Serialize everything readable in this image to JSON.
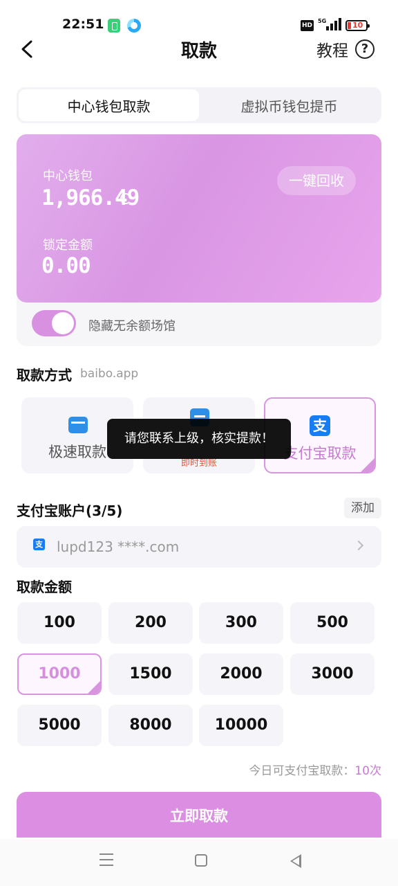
{
  "status_bar": {
    "time": "22:51",
    "hd": "HD",
    "network": "5G",
    "battery": "10"
  },
  "header": {
    "title": "取款",
    "tutorial_label": "教程",
    "help_glyph": "?"
  },
  "tabs": [
    {
      "label": "中心钱包取款",
      "active": true
    },
    {
      "label": "虚拟币钱包提币",
      "active": false
    }
  ],
  "wallet": {
    "center_label": "中心钱包",
    "balance": "1,966.49",
    "recall_button": "一键回收",
    "locked_label": "锁定金额",
    "locked_amount": "0.00",
    "hide_toggle_label": "隐藏无余额场馆",
    "hide_toggle_on": true
  },
  "methods": {
    "title": "取款方式",
    "subtitle": "baibo.app",
    "items": [
      {
        "label": "极速取款",
        "icon": "fast-withdraw-icon"
      },
      {
        "label": "",
        "sub": "即时到账",
        "icon": "bank-transfer-icon"
      },
      {
        "label": "支付宝取款",
        "icon": "alipay-icon",
        "selected": true
      }
    ]
  },
  "toast": "请您联系上级，核实提款！",
  "account": {
    "title": "支付宝账户(3/5)",
    "add_label": "添加",
    "value": "lupd123    ****.com"
  },
  "amounts": {
    "title": "取款金额",
    "options": [
      "100",
      "200",
      "300",
      "500",
      "1000",
      "1500",
      "2000",
      "3000",
      "5000",
      "8000",
      "10000"
    ],
    "selected": "1000"
  },
  "limit": {
    "prefix": "今日可支付宝取款：",
    "count": "10次"
  },
  "submit_label": "立即取款",
  "colors": {
    "accent": "#d894df",
    "card": "#dc9be5",
    "danger": "#e5533c",
    "alipay": "#1a7cf2"
  }
}
